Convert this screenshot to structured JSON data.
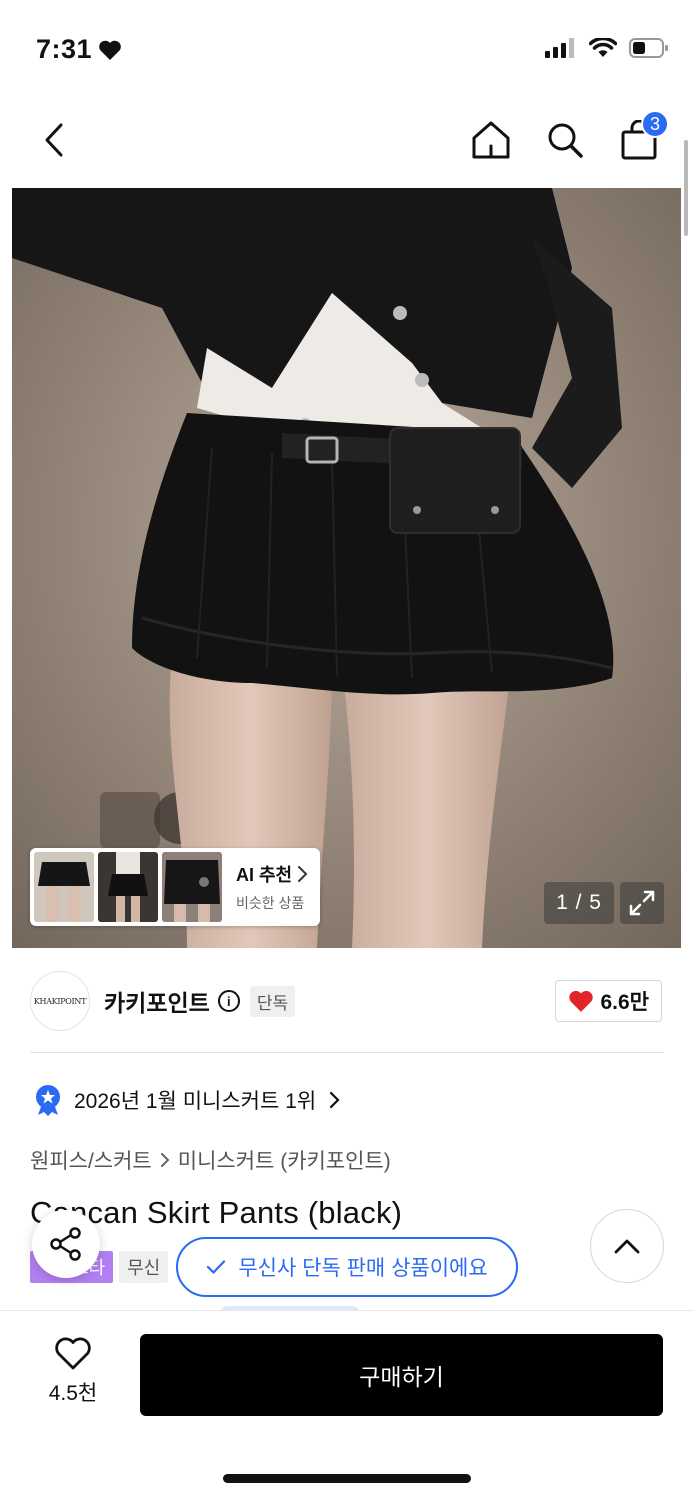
{
  "status_bar": {
    "time": "7:31"
  },
  "nav": {
    "cart_count": "3"
  },
  "image": {
    "counter": "1 / 5"
  },
  "ai_recommend": {
    "title": "AI 추천",
    "subtitle": "비슷한 상품"
  },
  "brand": {
    "logo_text": "KHAKIPOINT",
    "name": "카키포인트",
    "tag": "단독",
    "likes": "6.6만"
  },
  "ranking": {
    "text": "2026년 1월 미니스커트 1위"
  },
  "category": {
    "items": [
      "원피스/스커트",
      "미니스커트 (카키포인트)"
    ]
  },
  "product": {
    "title": "Cancan Skirt Pants (black)"
  },
  "tags": {
    "first": "스타",
    "second": "무신"
  },
  "exclusive": {
    "text": "무신사 단독 판매 상품이에요"
  },
  "bottom": {
    "wish_count": "4.5천",
    "buy_label": "구매하기"
  },
  "colors": {
    "accent": "#2b6bf3",
    "heart": "#e3232c",
    "tag_purple": "#b27ff3",
    "buy_bg": "#000000"
  }
}
